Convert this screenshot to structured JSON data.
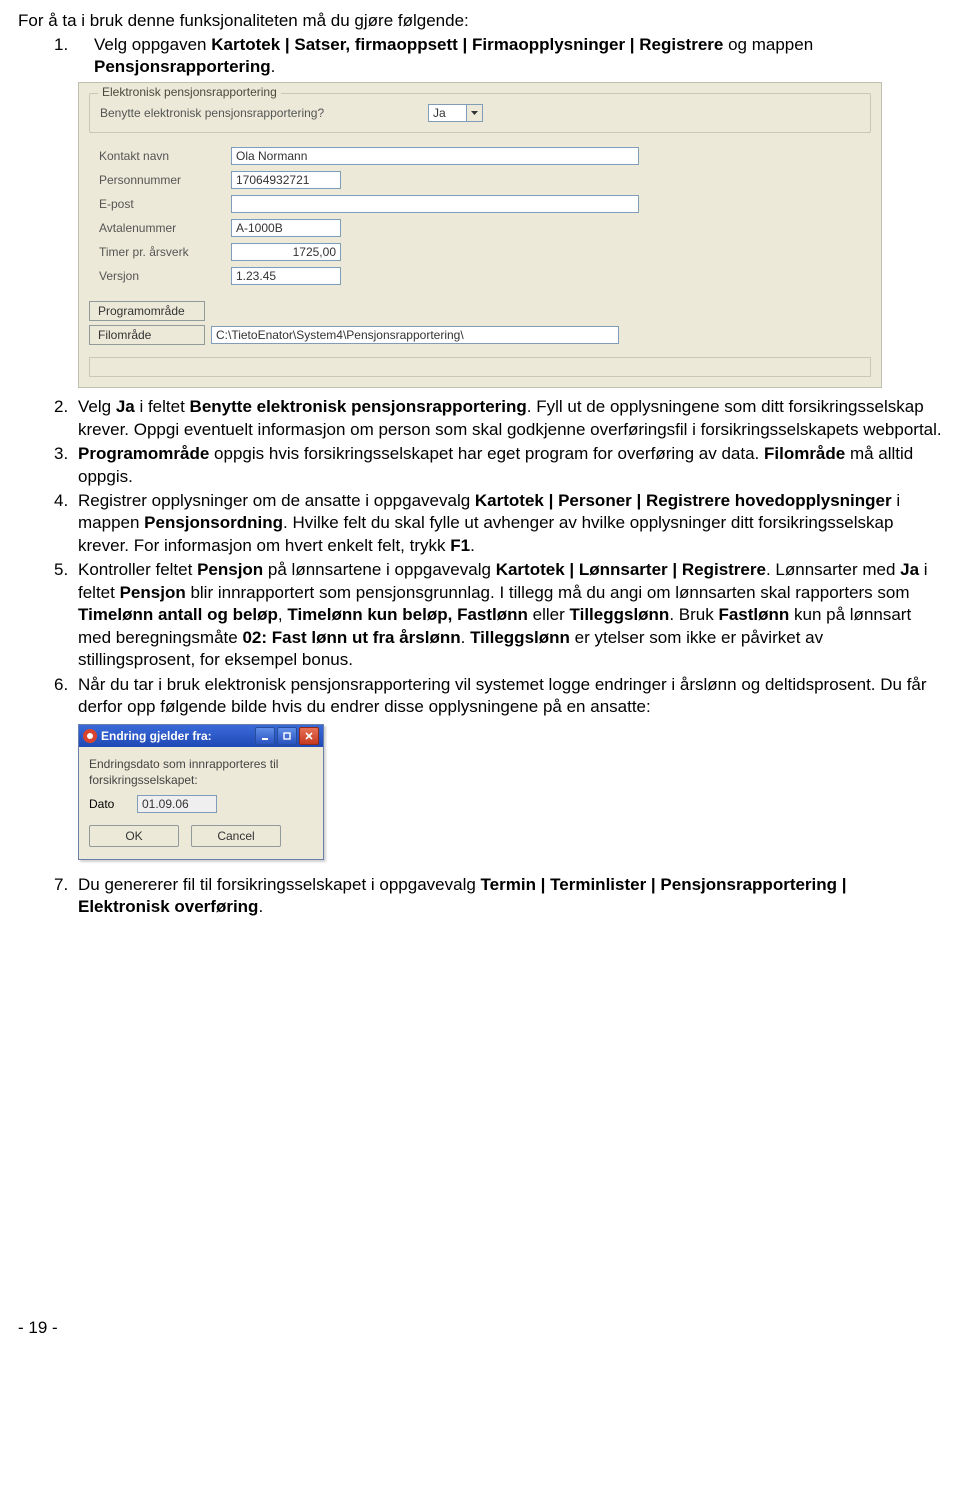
{
  "intro_text": "For å ta i bruk denne funksjonaliteten må du gjøre følgende:",
  "step1": {
    "number": "1.",
    "prefix": "Velg oppgaven ",
    "bold1": "Kartotek | Satser, firmaoppsett | Firmaopplysninger | Registrere",
    "mid1": " og mappen ",
    "bold2": "Pensjonsrapportering",
    "tail": "."
  },
  "shot1": {
    "group_title": "Elektronisk pensjonsrapportering",
    "q_label": "Benytte elektronisk pensjonsrapportering?",
    "q_value": "Ja",
    "fields": {
      "kontakt_label": "Kontakt navn",
      "kontakt_value": "Ola Normann",
      "personnummer_label": "Personnummer",
      "personnummer_value": "17064932721",
      "epost_label": "E-post",
      "epost_value": "",
      "avtalenummer_label": "Avtalenummer",
      "avtalenummer_value": "A-1000B",
      "timer_label": "Timer pr. årsverk",
      "timer_value": "1725,00",
      "versjon_label": "Versjon",
      "versjon_value": "1.23.45",
      "btn_program": "Programområde",
      "btn_fil": "Filområde",
      "filomrade_value": "C:\\TietoEnator\\System4\\Pensjonsrapportering\\"
    }
  },
  "steps": {
    "s2": {
      "num": "2.",
      "a": "Velg ",
      "b1": "Ja",
      "c": " i feltet ",
      "b2": "Benytte elektronisk pensjonsrapportering",
      "d": ". Fyll ut de opplysningene som ditt forsikringsselskap krever. Oppgi eventuelt informasjon om person som skal godkjenne overføringsfil i forsikringsselskapets webportal."
    },
    "s3": {
      "num": "3.",
      "b1": "Programområde",
      "a": " oppgis hvis forsikringsselskapet har eget program for overføring av data. ",
      "b2": "Filområde",
      "c": " må alltid oppgis."
    },
    "s4": {
      "num": "4.",
      "a": "Registrer opplysninger om de ansatte i oppgavevalg ",
      "b1": "Kartotek | Personer | Registrere hovedopplysninger",
      "c": " i mappen ",
      "b2": "Pensjonsordning",
      "d": ". Hvilke felt du skal fylle ut avhenger av hvilke opplysninger ditt forsikringsselskap krever. For informasjon om hvert enkelt felt, trykk ",
      "b3": "F1",
      "e": "."
    },
    "s5": {
      "num": "5.",
      "a": "Kontroller feltet ",
      "b1": "Pensjon",
      "c": " på lønnsartene i oppgavevalg ",
      "b2": "Kartotek | Lønnsarter | Registrere",
      "d": ". Lønnsarter med ",
      "b3": "Ja",
      "e": " i feltet ",
      "b4": "Pensjon",
      "f": " blir innrapportert som pensjonsgrunnlag. I tillegg må du angi om lønnsarten skal rapporters som ",
      "b5": "Timelønn antall og beløp",
      "g": ", ",
      "b6": "Timelønn kun beløp,",
      "h": " ",
      "b7": "Fastlønn",
      "i": " eller ",
      "b8": "Tilleggslønn",
      "j": ". Bruk ",
      "b9": "Fastlønn",
      "k": " kun på lønnsart med beregningsmåte ",
      "b10": "02: Fast lønn ut fra årslønn",
      "l": ". ",
      "b11": "Tilleggslønn",
      "m": " er ytelser som ikke er påvirket av stillingsprosent, for eksempel bonus."
    },
    "s6": {
      "num": "6.",
      "a": "Når du tar i bruk elektronisk pensjonsrapportering vil systemet logge endringer i årslønn og deltidsprosent. Du får derfor opp følgende bilde hvis du endrer disse opplysningene på en ansatte:"
    },
    "s7": {
      "num": "7.",
      "a": "Du genererer fil til forsikringsselskapet i oppgavevalg ",
      "b1": "Termin | Terminlister | Pensjonsrapportering | Elektronisk overføring",
      "c": "."
    }
  },
  "dialog": {
    "title": "Endring gjelder fra:",
    "label": "Endringsdato som innrapporteres til forsikringsselskapet:",
    "dato_label": "Dato",
    "dato_value": "01.09.06",
    "ok": "OK",
    "cancel": "Cancel"
  },
  "footer_page": "- 19 -"
}
